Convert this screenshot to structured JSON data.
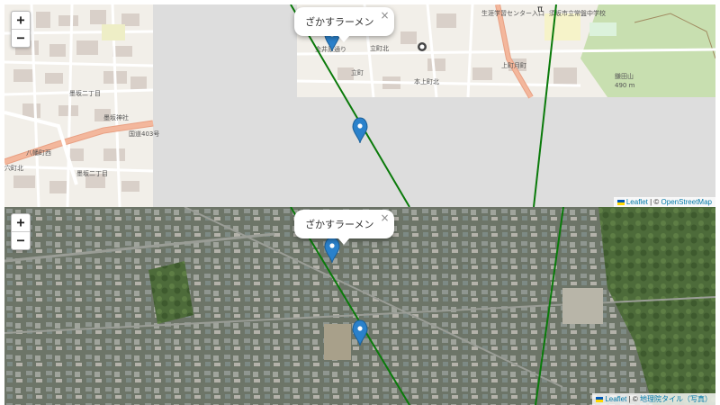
{
  "top_map": {
    "zoom_in": "+",
    "zoom_out": "−",
    "popup_text": "ざかすラーメン",
    "popup_close": "×",
    "attribution": {
      "leaflet": "Leaflet",
      "separator": " | © ",
      "source": "OpenStreetMap"
    },
    "labels": {
      "area_1": "墨坂二丁目",
      "area_2": "墨坂神社",
      "area_3": "国道403号",
      "area_4": "八幡町西",
      "area_5": "墨坂二丁目",
      "area_6": "穴町北",
      "school_1": "生涯学習センター入口",
      "school_2": "須坂市立常盤中学校",
      "mountain": "鎌田山",
      "mountain_elev": "490 m",
      "street_1": "立町北",
      "street_2": "立町",
      "street_3": "本上町北",
      "street_4": "上町月町",
      "street_5": "金井原通り",
      "street_6": "須坂市立",
      "letter_p": "P",
      "letter_tt": "π"
    }
  },
  "bottom_map": {
    "zoom_in": "+",
    "zoom_out": "−",
    "popup_text": "ざかすラーメン",
    "popup_close": "×",
    "attribution": {
      "leaflet": "Leaflet",
      "separator": " | © ",
      "source": "地理院タイル（写真）"
    }
  },
  "colors": {
    "route_line": "#0a7a0a",
    "marker": "#2a81cb",
    "major_road": "#f0a080",
    "osm_bg": "#f2efe9",
    "forest": "#c8dfb0",
    "gray_pane": "#dddddd"
  }
}
